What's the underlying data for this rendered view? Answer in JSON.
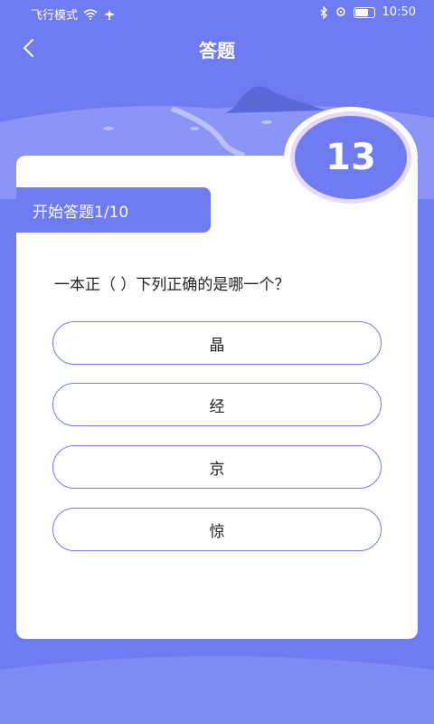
{
  "status_bar": {
    "left_text": "飞行模式",
    "time": "10:50",
    "icons": [
      "wifi-icon",
      "airplane-icon",
      "bluetooth-icon",
      "location-icon",
      "battery-icon"
    ]
  },
  "header": {
    "title": "答题",
    "back_icon": "chevron-left-icon"
  },
  "timer": {
    "value": "13"
  },
  "quiz": {
    "progress_label": "开始答题1/10",
    "question": "一本正（ ）下列正确的是哪一个？",
    "options": [
      {
        "label": "晶"
      },
      {
        "label": "经"
      },
      {
        "label": "京"
      },
      {
        "label": "惊"
      }
    ]
  },
  "colors": {
    "background": "#6f7bf0",
    "accent": "#6f7bf0",
    "card": "#ffffff"
  }
}
